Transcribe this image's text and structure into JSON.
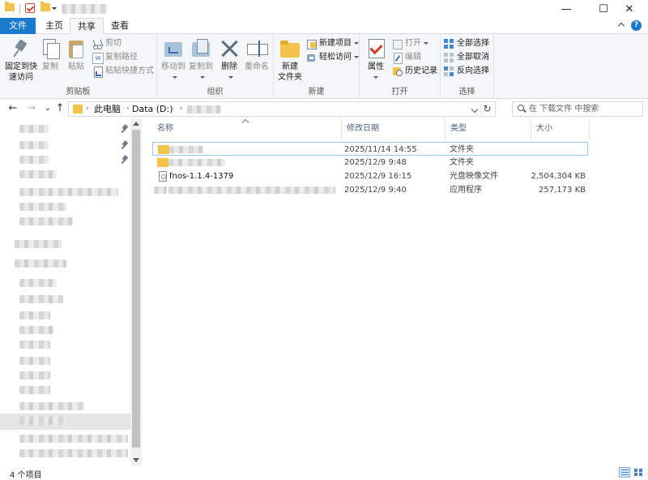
{
  "window": {
    "minimize_glyph": "—",
    "maximize_glyph": "☐",
    "close_glyph": "✕"
  },
  "ribbon_tabs": {
    "file": "文件",
    "home": "主页",
    "share": "共享",
    "view": "查看"
  },
  "ribbon": {
    "clipboard": {
      "label": "剪贴板",
      "pin_quick_access_line1": "固定到快",
      "pin_quick_access_line2": "速访问",
      "copy": "复制",
      "paste": "粘贴",
      "cut": "剪切",
      "copy_path": "复制路径",
      "paste_shortcut": "粘贴快捷方式"
    },
    "organize": {
      "label": "组织",
      "move_to": "移动到",
      "copy_to": "复制到",
      "delete": "删除",
      "rename": "重命名"
    },
    "new": {
      "label": "新建",
      "new_folder_line1": "新建",
      "new_folder_line2": "文件夹",
      "new_item": "新建项目",
      "easy_access": "轻松访问"
    },
    "open": {
      "label": "打开",
      "properties": "属性",
      "open": "打开",
      "edit": "编辑",
      "history": "历史记录"
    },
    "select": {
      "label": "选择",
      "select_all": "全部选择",
      "select_none": "全部取消",
      "invert_selection": "反向选择"
    }
  },
  "address": {
    "crumbs": [
      "此电脑",
      "Data (D:)"
    ],
    "refresh_glyph": "↻",
    "back_glyph": "←",
    "forward_glyph": "→",
    "recent_glyph": "⌄",
    "up_glyph": "↑"
  },
  "search": {
    "placeholder": "在 下载文件 中搜索"
  },
  "columns": {
    "name": "名称",
    "modified": "修改日期",
    "type": "类型",
    "size": "大小"
  },
  "files": [
    {
      "name": "",
      "modified": "2025/11/14 14:55",
      "type": "文件夹",
      "size": "",
      "icon": "folder-icon"
    },
    {
      "name": "",
      "modified": "2025/12/9 9:48",
      "type": "文件夹",
      "size": "",
      "icon": "folder-icon"
    },
    {
      "name": "fnos-1.1.4-1379",
      "modified": "2025/12/9 16:15",
      "type": "光盘映像文件",
      "size": "2,504,304 KB",
      "icon": "disc-image-icon"
    },
    {
      "name": "",
      "modified": "2025/12/9 9:40",
      "type": "应用程序",
      "size": "257,173 KB",
      "icon": "application-icon"
    }
  ],
  "status": {
    "item_count": "4 个项目"
  },
  "colors": {
    "accent": "#1979ca",
    "selection_border": "#99c9ef",
    "folder": "#f4c34b"
  }
}
